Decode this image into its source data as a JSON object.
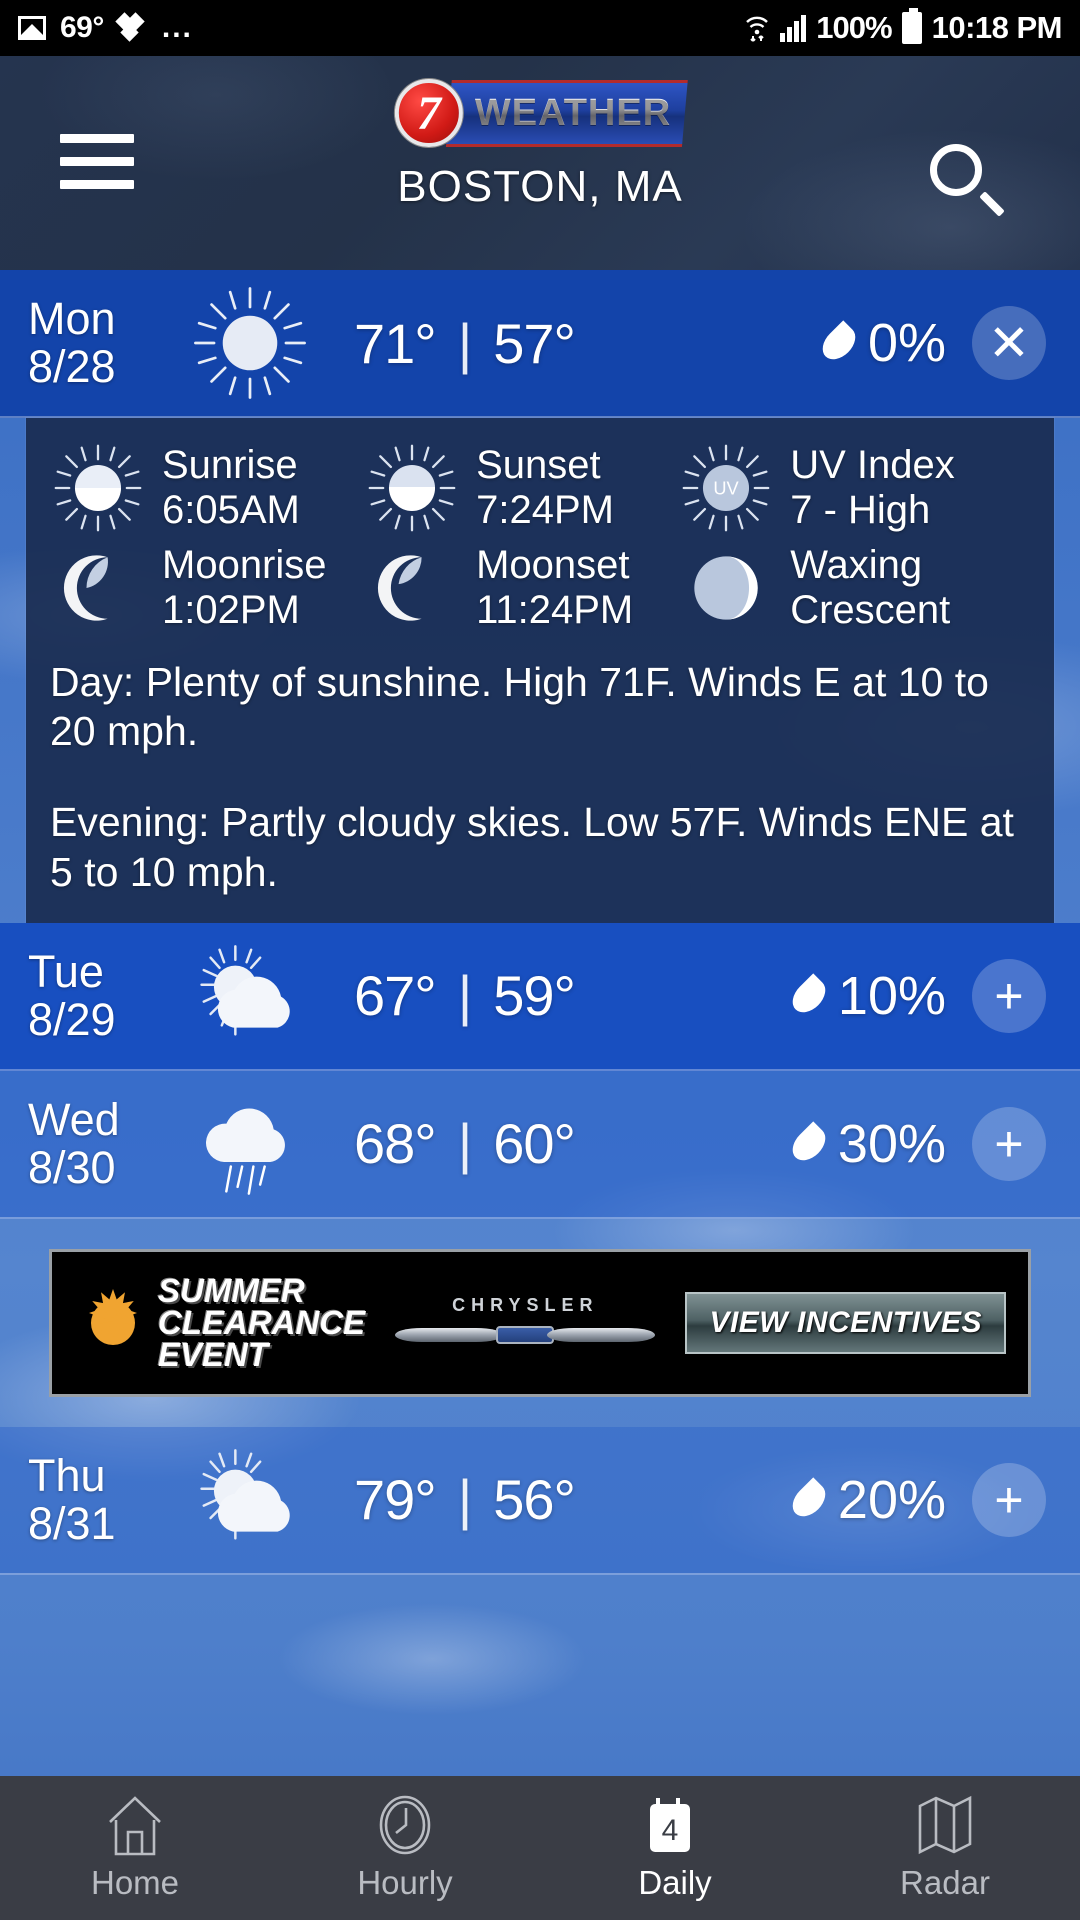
{
  "status_bar": {
    "photo_icon": "photo-icon",
    "temperature": "69°",
    "dropbox_icon": "dropbox-icon",
    "more_dots": "...",
    "wifi_icon": "wifi-icon",
    "signal_icon": "signal-icon",
    "battery_percent": "100%",
    "battery_icon": "battery-icon",
    "clock": "10:18 PM"
  },
  "header": {
    "menu_icon": "hamburger-menu-icon",
    "logo_number": "7",
    "logo_word": "WEATHER",
    "location": "BOSTON, MA",
    "search_icon": "search-icon"
  },
  "selected_day": {
    "day": "Mon",
    "date": "8/28",
    "condition_icon": "sun-icon",
    "high": "71°",
    "separator": "|",
    "low": "57°",
    "precip_icon": "water-drop-icon",
    "precip": "0%",
    "collapse_label": "✕",
    "detail": {
      "astro": [
        {
          "icon": "sunrise-icon",
          "label": "Sunrise",
          "value": "6:05AM"
        },
        {
          "icon": "sunset-icon",
          "label": "Sunset",
          "value": "7:24PM"
        },
        {
          "icon": "uv-index-icon",
          "label": "UV Index",
          "value": "7 - High"
        },
        {
          "icon": "moonrise-icon",
          "label": "Moonrise",
          "value": "1:02PM"
        },
        {
          "icon": "moonset-icon",
          "label": "Moonset",
          "value": "11:24PM"
        },
        {
          "icon": "moon-phase-icon",
          "label": "Waxing",
          "value": "Crescent"
        }
      ],
      "day_forecast": "Day: Plenty of sunshine. High 71F. Winds E at 10 to 20 mph.",
      "evening_forecast": "Evening: Partly cloudy skies. Low 57F. Winds ENE at 5 to 10 mph."
    }
  },
  "days": [
    {
      "day": "Tue",
      "date": "8/29",
      "condition_icon": "partly-cloudy-icon",
      "high": "67°",
      "separator": "|",
      "low": "59°",
      "precip_icon": "water-drop-icon",
      "precip": "10%",
      "expand_label": "+"
    },
    {
      "day": "Wed",
      "date": "8/30",
      "condition_icon": "rain-icon",
      "high": "68°",
      "separator": "|",
      "low": "60°",
      "precip_icon": "water-drop-icon",
      "precip": "30%",
      "expand_label": "+"
    },
    {
      "day": "Thu",
      "date": "8/31",
      "condition_icon": "partly-cloudy-icon",
      "high": "79°",
      "separator": "|",
      "low": "56°",
      "precip_icon": "water-drop-icon",
      "precip": "20%",
      "expand_label": "+"
    }
  ],
  "ad": {
    "line1": "SUMMER",
    "line2": "CLEARANCE",
    "line3": "EVENT",
    "brand": "CHRYSLER",
    "cta": "VIEW INCENTIVES",
    "sun_icon": "sunburst-icon",
    "wings_icon": "chrysler-wings-icon"
  },
  "bottom_nav": [
    {
      "icon": "home-icon",
      "label": "Home",
      "active": false
    },
    {
      "icon": "clock-icon",
      "label": "Hourly",
      "active": false
    },
    {
      "icon": "calendar-icon",
      "label": "Daily",
      "active": true,
      "badge": "4"
    },
    {
      "icon": "map-icon",
      "label": "Radar",
      "active": false
    }
  ],
  "colors": {
    "accent_blue": "#1a51b0",
    "header_navy": "#25344f",
    "panel_navy": "#182a4e",
    "nav_bar": "#3a3d45",
    "logo_red": "#d11a16",
    "ad_orange": "#f0a431"
  }
}
